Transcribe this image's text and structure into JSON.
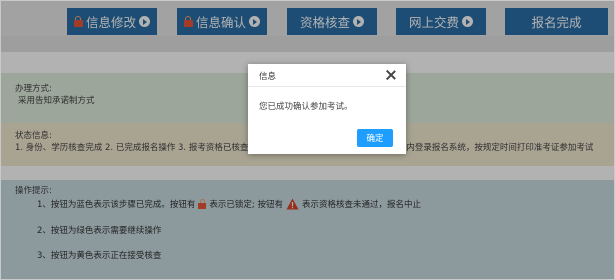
{
  "steps": [
    {
      "label": "信息修改",
      "locked": true
    },
    {
      "label": "信息确认",
      "locked": true
    },
    {
      "label": "资格核查",
      "locked": false
    },
    {
      "label": "网上交费",
      "locked": false
    },
    {
      "label": "报名完成",
      "locked": false
    }
  ],
  "method": {
    "title": "办理方式:",
    "text": "采用告知承诺制方式"
  },
  "status": {
    "title": "状态信息:",
    "text": "1. 身份、学历核查完成 2. 已完成报名操作 3. 报考资格已核查 4. 已成功交费，报名成功！请于考前一周内登录报名系统，按规定时间打印准考证参加考试"
  },
  "tips": {
    "title": "操作提示:",
    "line1_before": "1、按钮为蓝色表示该步骤已完成。按钮有",
    "line1_mid1": "表示已锁定; 按钮有",
    "line1_mid2": "表示资格核查未通过，报名中止",
    "line2": "2、按钮为绿色表示需要继续操作",
    "line3": "3、按钮为黄色表示正在接受核查"
  },
  "dialog": {
    "title": "信息",
    "message": "您已成功确认参加考试。",
    "ok_label": "确定"
  },
  "colors": {
    "step_blue": "#2a6fa8",
    "ok_button": "#1e9fff",
    "lock_red": "#e8573c",
    "warn_red": "#d9442c"
  },
  "icons": [
    "lock-icon",
    "arrow-right-circle-icon",
    "warning-icon",
    "close-icon"
  ]
}
